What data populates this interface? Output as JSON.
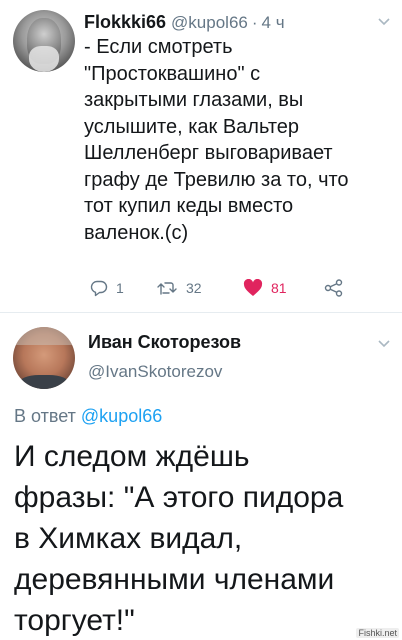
{
  "tweet1": {
    "author_name": "Flokkki66",
    "author_handle": "@kupol66",
    "separator": "·",
    "time": "4 ч",
    "text_lines": [
      "- Если смотреть",
      "\"Простоквашино\" с",
      "закрытыми глазами, вы",
      "услышите, как Вальтер",
      "Шелленберг выговаривает",
      "графу де Тревилю за то, что",
      "тот купил кеды вместо",
      "валенок.(с)"
    ],
    "actions": {
      "reply_count": "1",
      "retweet_count": "32",
      "like_count": "81"
    },
    "icons": {
      "reply": "reply-icon",
      "retweet": "retweet-icon",
      "like": "heart-icon",
      "share": "share-icon",
      "menu": "chevron-down-icon"
    }
  },
  "tweet2": {
    "author_name": "Иван Скоторезов",
    "author_handle": "@IvanSkotorezov",
    "reply_prefix": "В ответ",
    "reply_mention": "@kupol66",
    "text_lines": [
      "И следом ждёшь",
      "фразы: \"А этого пидора",
      "в Химках видал,",
      "деревянными членами",
      "торгует!\""
    ]
  },
  "watermark": "Fishki.net",
  "colors": {
    "text": "#14171a",
    "secondary": "#657786",
    "link": "#1da1f2",
    "like": "#e0245e",
    "divider": "#e6ecf0"
  }
}
